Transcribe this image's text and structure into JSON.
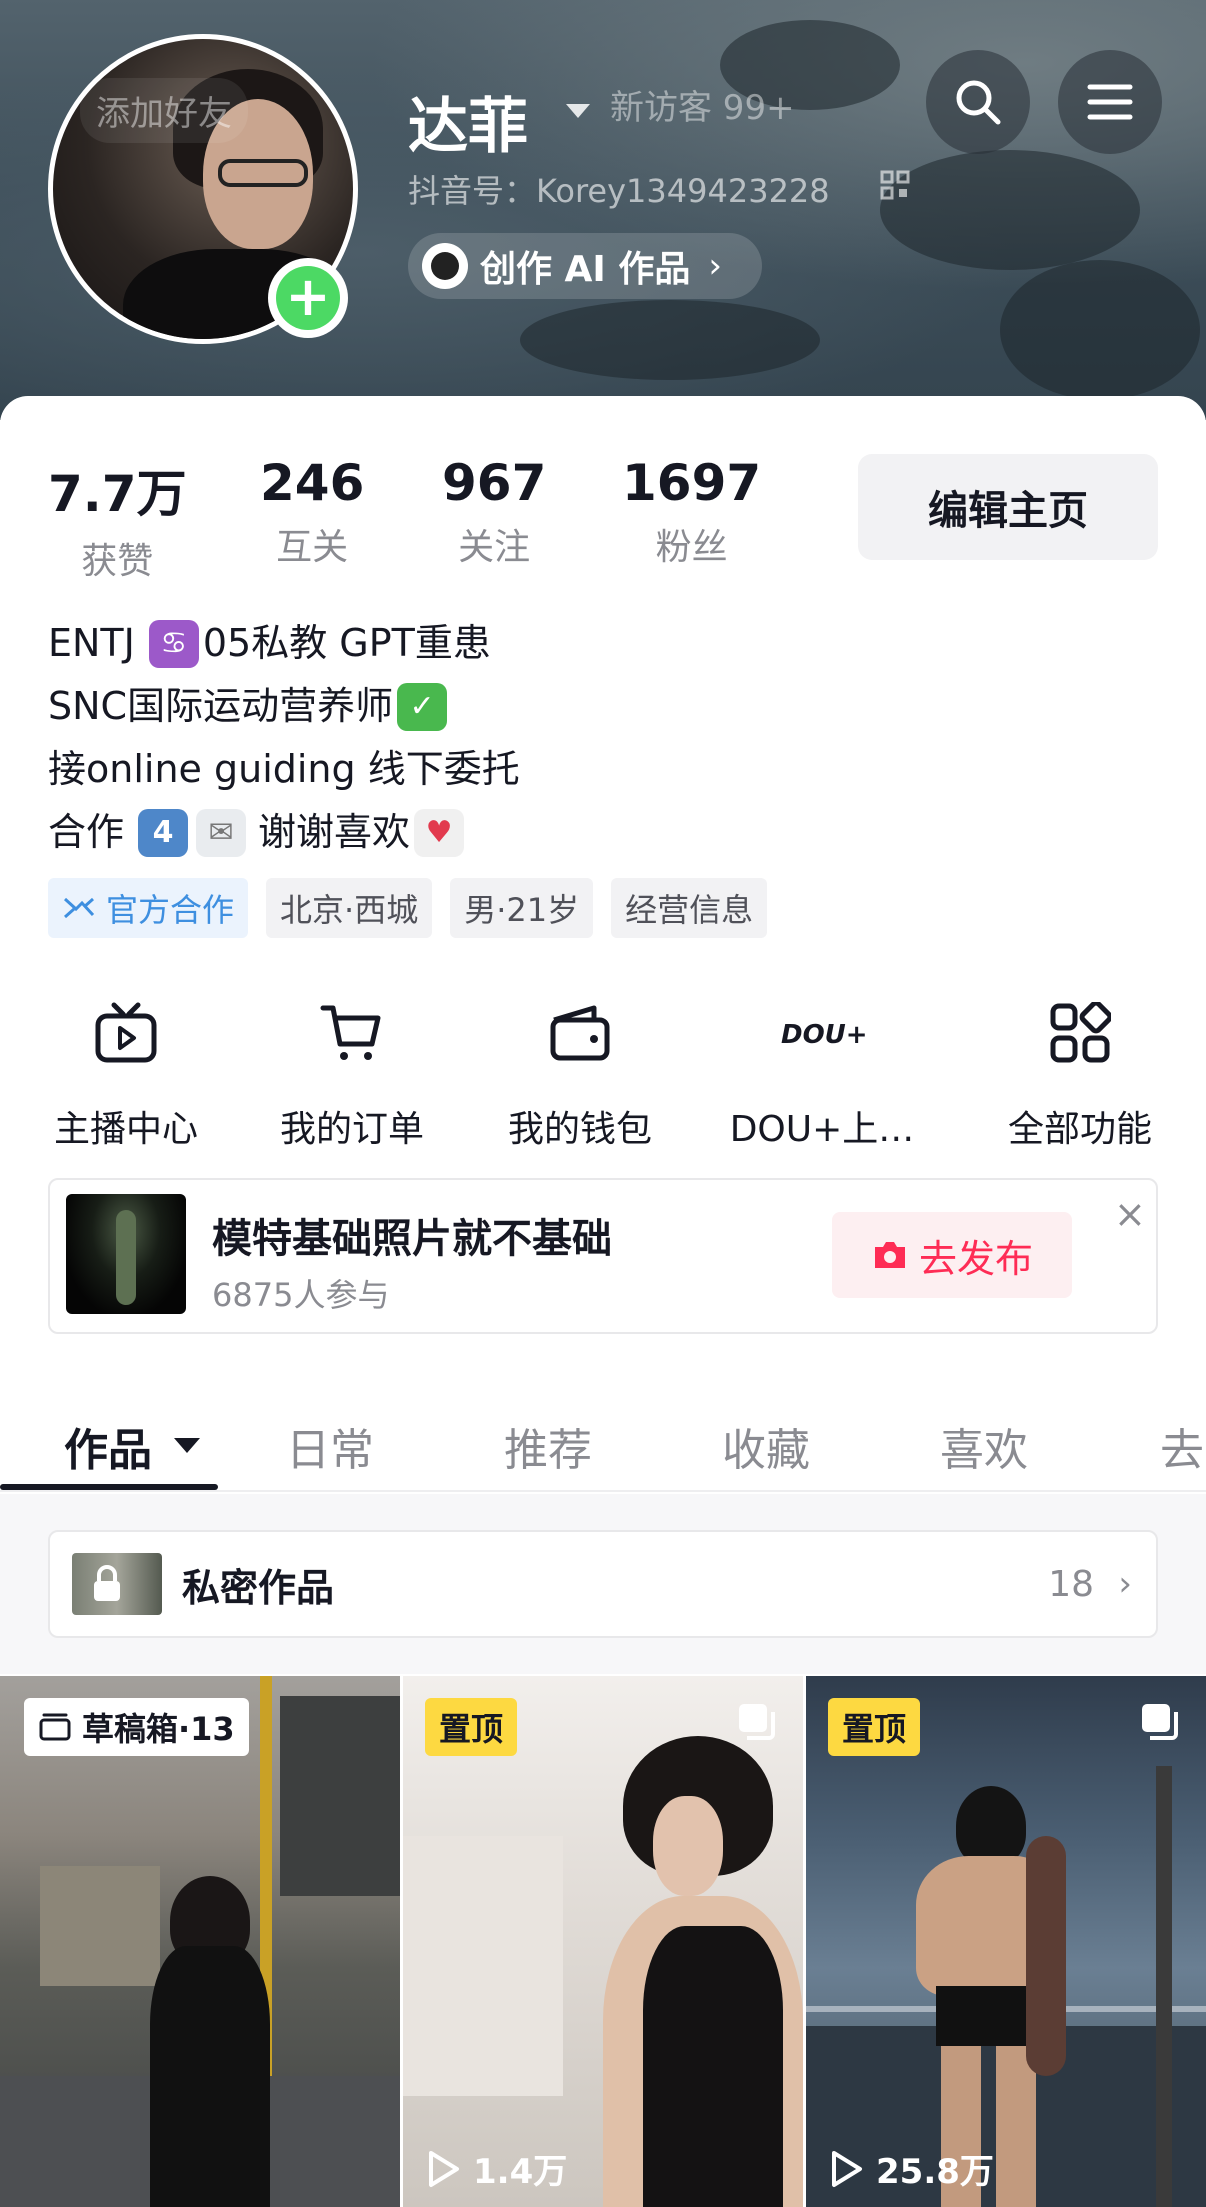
{
  "header": {
    "add_friend_ghost": "添加好友",
    "nickname": "达菲",
    "visitors_ghost": "新访客 99+",
    "douyin_id": "抖音号：Korey1349423228",
    "ai_button_label": "创作 AI 作品",
    "ai_button_chevron": "›",
    "search_icon": "search-icon",
    "menu_icon": "menu-icon"
  },
  "stats": [
    {
      "value": "7.7万",
      "label": "获赞"
    },
    {
      "value": "246",
      "label": "互关"
    },
    {
      "value": "967",
      "label": "关注"
    },
    {
      "value": "1697",
      "label": "粉丝"
    }
  ],
  "edit_profile_label": "编辑主页",
  "bio": {
    "line1_a": "ENTJ",
    "line1_b": "05私教 GPT重患",
    "line2_a": "SNC国际运动营养师",
    "line3": "接online guiding 线下委托",
    "line4_a": "合作",
    "line4_b": "谢谢喜欢",
    "emoji_cancer": "♋",
    "emoji_check": "✓",
    "emoji_four": "4",
    "emoji_envelope": "✉",
    "emoji_heart": "♥"
  },
  "tags": [
    "官方合作",
    "北京·西城",
    "男·21岁",
    "经营信息"
  ],
  "features": [
    {
      "label": "主播中心",
      "icon": "tv-play-icon"
    },
    {
      "label": "我的订单",
      "icon": "cart-icon"
    },
    {
      "label": "我的钱包",
      "icon": "wallet-icon"
    },
    {
      "label": "DOU+上…",
      "icon": "dou-plus-icon",
      "logo_text": "DOU+"
    },
    {
      "label": "全部功能",
      "icon": "grid-apps-icon"
    }
  ],
  "challenge": {
    "title": "模特基础照片就不基础",
    "participants": "6875人参与",
    "publish_label": "去发布",
    "close": "×"
  },
  "tabs": [
    "作品",
    "日常",
    "推荐",
    "收藏",
    "喜欢",
    "去"
  ],
  "private_works": {
    "label": "私密作品",
    "count": "18",
    "chevron": "›"
  },
  "grid": [
    {
      "badge": "草稿箱·13"
    },
    {
      "badge": "置顶",
      "plays": "1.4万"
    },
    {
      "badge": "置顶",
      "plays": "25.8万"
    }
  ],
  "colors": {
    "accent_red": "#fe2c55",
    "official_blue": "#3e8fe0",
    "plus_green": "#4cd964",
    "pin_yellow": "#fdd941"
  }
}
